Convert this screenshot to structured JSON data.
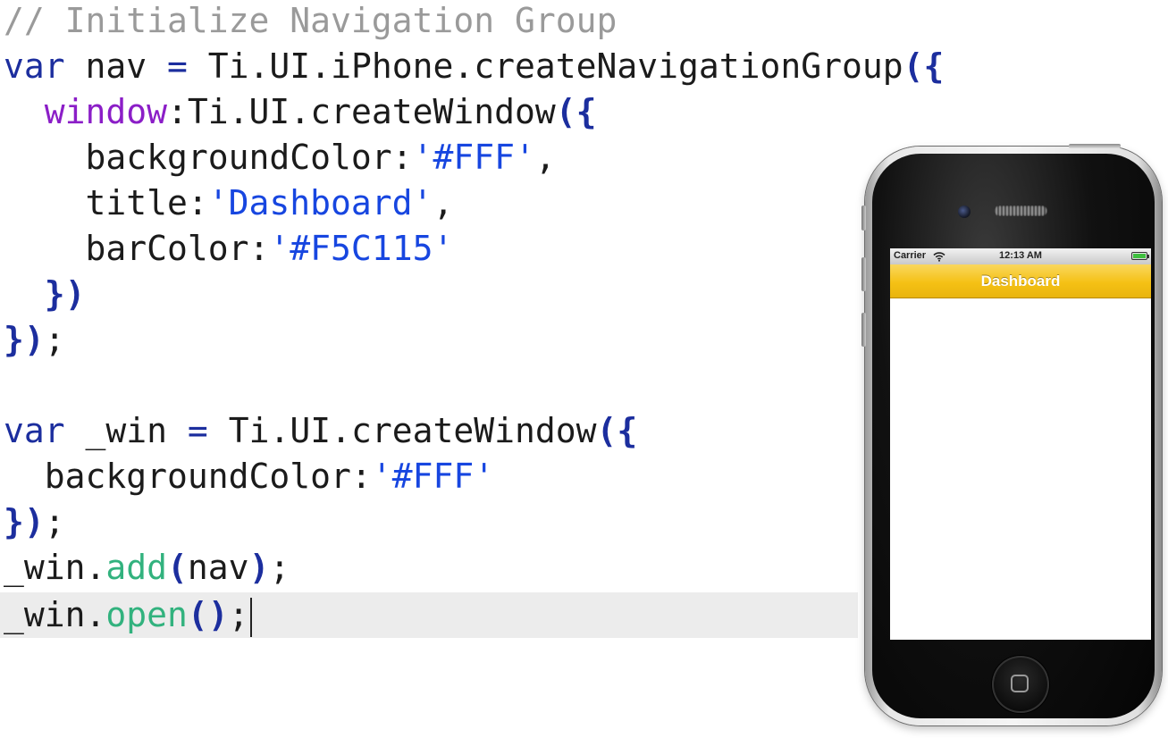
{
  "editor": {
    "lines": [
      {
        "tokens": [
          {
            "text": "// Initialize Navigation Group",
            "kind": "comment"
          }
        ]
      },
      {
        "tokens": [
          {
            "text": "var",
            "kind": "kw"
          },
          {
            "text": " nav ",
            "kind": "plain"
          },
          {
            "text": "=",
            "kind": "kw"
          },
          {
            "text": " Ti.UI.iPhone.createNavigationGroup",
            "kind": "plain"
          },
          {
            "text": "({",
            "kind": "brace"
          }
        ]
      },
      {
        "tokens": [
          {
            "text": "  ",
            "kind": "plain"
          },
          {
            "text": "window",
            "kind": "prop"
          },
          {
            "text": ":Ti.UI.createWindow",
            "kind": "plain"
          },
          {
            "text": "({",
            "kind": "brace"
          }
        ]
      },
      {
        "tokens": [
          {
            "text": "    backgroundColor:",
            "kind": "plain"
          },
          {
            "text": "'#FFF'",
            "kind": "str"
          },
          {
            "text": ",",
            "kind": "plain"
          }
        ]
      },
      {
        "tokens": [
          {
            "text": "    title:",
            "kind": "plain"
          },
          {
            "text": "'Dashboard'",
            "kind": "str"
          },
          {
            "text": ",",
            "kind": "plain"
          }
        ]
      },
      {
        "tokens": [
          {
            "text": "    barColor:",
            "kind": "plain"
          },
          {
            "text": "'#F5C115'",
            "kind": "str"
          }
        ]
      },
      {
        "tokens": [
          {
            "text": "  ",
            "kind": "plain"
          },
          {
            "text": "})",
            "kind": "brace"
          }
        ]
      },
      {
        "tokens": [
          {
            "text": "})",
            "kind": "brace"
          },
          {
            "text": ";",
            "kind": "plain"
          }
        ]
      },
      {
        "tokens": []
      },
      {
        "tokens": [
          {
            "text": "var",
            "kind": "kw"
          },
          {
            "text": " _win ",
            "kind": "plain"
          },
          {
            "text": "=",
            "kind": "kw"
          },
          {
            "text": " Ti.UI.createWindow",
            "kind": "plain"
          },
          {
            "text": "({",
            "kind": "brace"
          }
        ]
      },
      {
        "tokens": [
          {
            "text": "  backgroundColor:",
            "kind": "plain"
          },
          {
            "text": "'#FFF'",
            "kind": "str"
          }
        ]
      },
      {
        "tokens": [
          {
            "text": "})",
            "kind": "brace"
          },
          {
            "text": ";",
            "kind": "plain"
          }
        ]
      },
      {
        "tokens": [
          {
            "text": "_win.",
            "kind": "plain"
          },
          {
            "text": "add",
            "kind": "method"
          },
          {
            "text": "(",
            "kind": "brace"
          },
          {
            "text": "nav",
            "kind": "plain"
          },
          {
            "text": ")",
            "kind": "brace"
          },
          {
            "text": ";",
            "kind": "plain"
          }
        ]
      },
      {
        "current": true,
        "tokens": [
          {
            "text": "_win.",
            "kind": "plain"
          },
          {
            "text": "open",
            "kind": "method"
          },
          {
            "text": "()",
            "kind": "brace"
          },
          {
            "text": ";",
            "kind": "plain"
          }
        ]
      }
    ]
  },
  "simulator": {
    "status_bar": {
      "carrier": "Carrier",
      "time": "12:13 AM",
      "wifi_icon": "wifi-icon",
      "battery_icon": "battery-full-icon",
      "battery_level": 1.0
    },
    "nav_bar": {
      "title": "Dashboard",
      "bar_color": "#F5C115"
    },
    "window_background": "#FFFFFF",
    "home_button_icon": "home-square-icon"
  },
  "colors": {
    "comment": "#9a9a9a",
    "keyword": "#1c2e9e",
    "property": "#8b1ec7",
    "string": "#1746e0",
    "method": "#32b27e",
    "current_line_highlight": "#ececec"
  }
}
